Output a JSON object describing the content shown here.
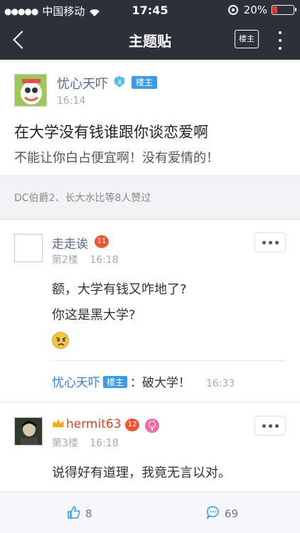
{
  "status": {
    "carrier": "中国移动",
    "time": "17:45",
    "battery": "20%",
    "battery_level": 0.2
  },
  "nav": {
    "title": "主题贴",
    "owner_label": "楼主"
  },
  "post": {
    "author": "忧心天吓",
    "level": "4",
    "owner_tag": "楼主",
    "time": "16:14",
    "title": "在大学没有钱谁跟你谈恋爱啊",
    "body": "不能让你白占便宜啊！没有爱情的！"
  },
  "likes_text": "DC伯爵2、长大水比等8人赞过",
  "replies": [
    {
      "author": "走走诶",
      "level": "11",
      "floor": "第2楼",
      "time": "16:18",
      "lines": [
        "额，大学有钱又咋地了?",
        "你这是黑大学?"
      ],
      "emoji_icon": "angry-face-icon",
      "sub": {
        "author": "忧心天吓",
        "owner_tag": "楼主",
        "text": "：破大学！",
        "time": "16:33"
      }
    },
    {
      "author": "hermit63",
      "level": "12",
      "floor": "第3楼",
      "time": "16:18",
      "lines": [
        "说得好有道理，我竟无言以对。"
      ]
    }
  ],
  "bottom": {
    "like_count": "8",
    "comment_count": "69"
  },
  "colors": {
    "bar": "#2e3139",
    "accent_blue": "#3d9be8",
    "level_badge": "#ef5535",
    "name": "#5a6b8c"
  }
}
